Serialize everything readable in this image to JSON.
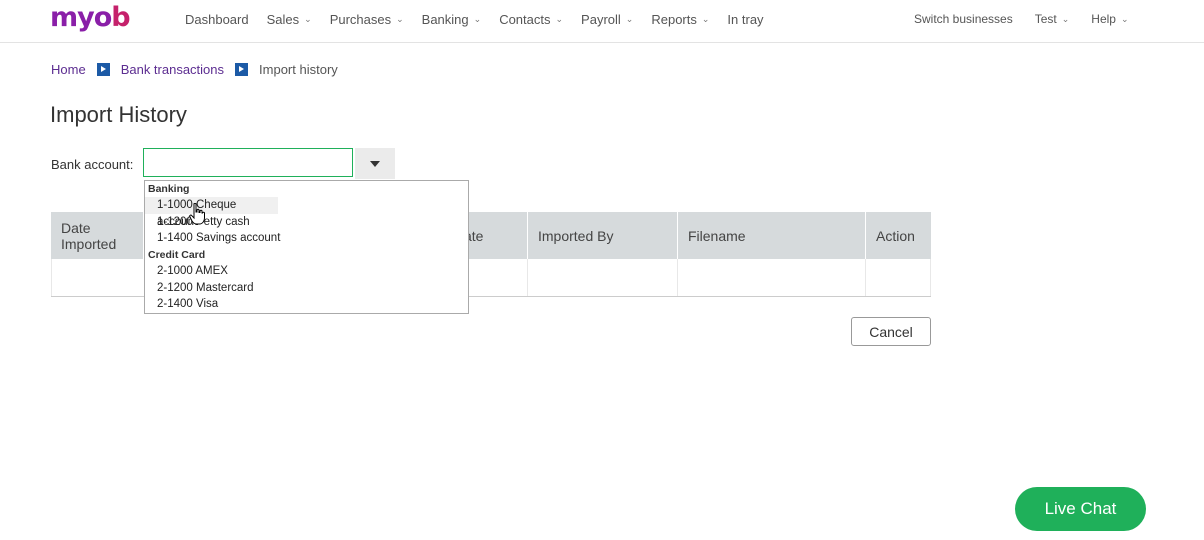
{
  "brand": {
    "logo_main": "myo",
    "logo_end": "b"
  },
  "nav": {
    "left": [
      {
        "label": "Dashboard",
        "dropdown": false
      },
      {
        "label": "Sales",
        "dropdown": true
      },
      {
        "label": "Purchases",
        "dropdown": true
      },
      {
        "label": "Banking",
        "dropdown": true
      },
      {
        "label": "Contacts",
        "dropdown": true
      },
      {
        "label": "Payroll",
        "dropdown": true
      },
      {
        "label": "Reports",
        "dropdown": true
      },
      {
        "label": "In tray",
        "dropdown": false
      }
    ],
    "right": [
      {
        "label": "Switch businesses",
        "dropdown": false
      },
      {
        "label": "Test",
        "dropdown": true
      },
      {
        "label": "Help",
        "dropdown": true
      }
    ]
  },
  "breadcrumb": {
    "home": "Home",
    "bank_transactions": "Bank transactions",
    "current": "Import history"
  },
  "page": {
    "title": "Import History"
  },
  "bank_account": {
    "label": "Bank account:",
    "value": ""
  },
  "dropdown": {
    "banking_group": "Banking",
    "banking": [
      "1-1000 Cheque account",
      "1-1200 Petty cash",
      "1-1400 Savings account"
    ],
    "credit_group": "Credit Card",
    "credit": [
      "2-1000 AMEX",
      "2-1200 Mastercard",
      "2-1400 Visa"
    ]
  },
  "table": {
    "headers": [
      "Date Imported",
      "",
      "ate",
      "Imported By",
      "Filename",
      "Action"
    ]
  },
  "buttons": {
    "cancel": "Cancel",
    "live_chat": "Live Chat"
  },
  "colors": {
    "brand_purple": "#8a1fa8",
    "brand_pink": "#c5216b",
    "accent_green": "#1fb05a",
    "breadcrumb_link": "#5c2d91"
  }
}
